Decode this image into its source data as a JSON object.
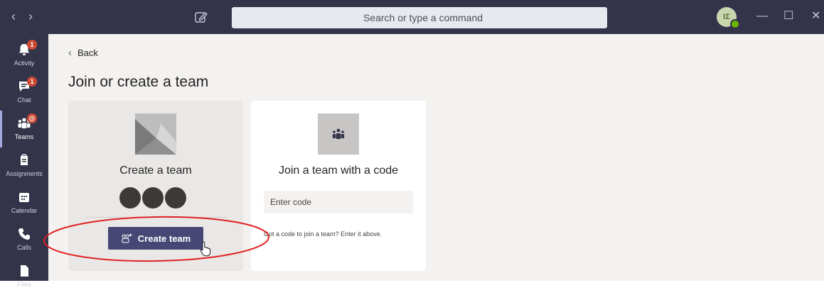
{
  "titlebar": {
    "back_icon": "chevron-left-icon",
    "forward_icon": "chevron-right-icon",
    "compose_icon": "compose-icon",
    "search_placeholder": "Search or type a command",
    "avatar_initials": "IΣ",
    "minimize_glyph": "—",
    "maximize_glyph": "☐",
    "close_glyph": "✕"
  },
  "sidebar": {
    "items": [
      {
        "label": "Activity",
        "badge": "1",
        "icon": "bell-icon"
      },
      {
        "label": "Chat",
        "badge": "1",
        "icon": "chat-icon"
      },
      {
        "label": "Teams",
        "badge": "@",
        "icon": "teams-icon",
        "active": true
      },
      {
        "label": "Assignments",
        "badge": "",
        "icon": "assignments-icon"
      },
      {
        "label": "Calendar",
        "badge": "",
        "icon": "calendar-icon"
      },
      {
        "label": "Calls",
        "badge": "",
        "icon": "phone-icon"
      },
      {
        "label": "Files",
        "badge": "",
        "icon": "file-icon"
      }
    ]
  },
  "main": {
    "back_label": "Back",
    "title": "Join or create a team",
    "create_card": {
      "title": "Create a team",
      "button_label": "Create team"
    },
    "join_card": {
      "title": "Join a team with a code",
      "input_placeholder": "Enter code",
      "hint": "Got a code to join a team? Enter it above."
    }
  },
  "colors": {
    "rail": "#33344a",
    "accent": "#464775",
    "badge": "#cc4a31",
    "annotation": "#e02020"
  }
}
